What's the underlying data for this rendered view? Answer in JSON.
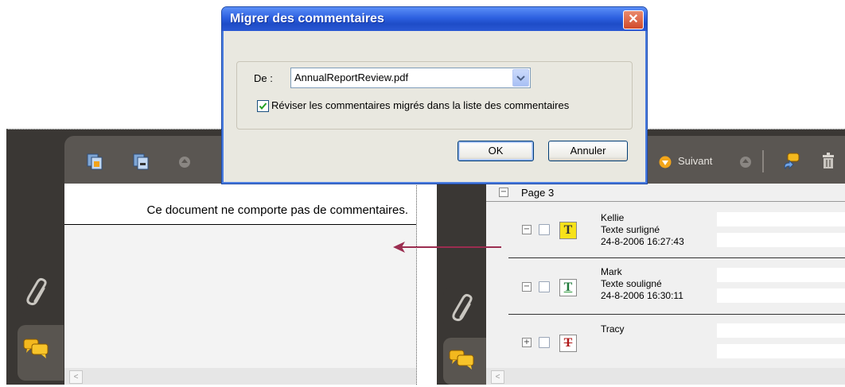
{
  "dialog": {
    "title": "Migrer des commentaires",
    "close_glyph": "✕",
    "from_label": "De :",
    "from_value": "AnnualReportReview.pdf",
    "review_checkbox_label": "Réviser les commentaires migrés dans la liste des commentaires",
    "review_checked": true,
    "ok_label": "OK",
    "cancel_label": "Annuler"
  },
  "left_panel": {
    "empty_message": "Ce document ne comporte pas de commentaires.",
    "scroll_left_glyph": "<"
  },
  "right_panel": {
    "next_label": "Suivant",
    "page_label": "Page 3",
    "scroll_left_glyph": "<",
    "comments": [
      {
        "author": "Kellie",
        "type": "Texte surligné",
        "date": "24-8-2006 16:27:43",
        "icon": "highlight-text-icon",
        "expander": "−"
      },
      {
        "author": "Mark",
        "type": "Texte souligné",
        "date": "24-8-2006 16:30:11",
        "icon": "underline-text-icon",
        "expander": "−"
      },
      {
        "author": "Tracy",
        "type": "",
        "date": "",
        "icon": "strikethrough-text-icon",
        "expander": "+"
      }
    ],
    "page_expander": "−"
  },
  "colors": {
    "panel_dark": "#3a3734",
    "accent_arrow": "#9b2d50",
    "dialog_title_blue": "#2d60e0"
  }
}
